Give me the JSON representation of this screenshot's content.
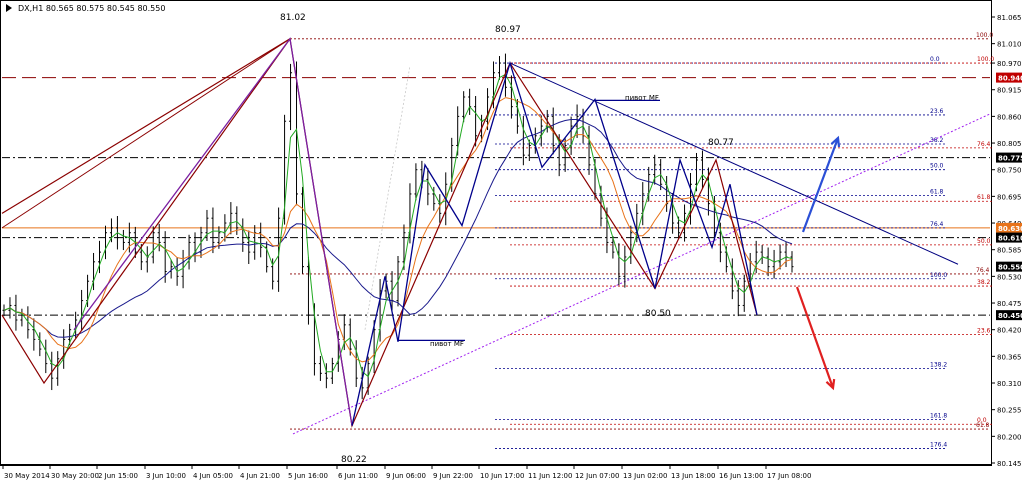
{
  "window": {
    "header": "DX,H1  80.565 80.575 80.545 80.550"
  },
  "chart_data": {
    "type": "candlestick",
    "symbol": "DX",
    "timeframe": "H1",
    "ylim": [
      80.165,
      81.085
    ],
    "grid": false,
    "price_axis": {
      "ticks": [
        "81.065",
        "81.010",
        "80.970",
        "80.915",
        "80.860",
        "80.805",
        "80.750",
        "80.695",
        "80.640",
        "80.585",
        "80.530",
        "80.475",
        "80.420",
        "80.365",
        "80.310",
        "80.255",
        "80.200",
        "80.145"
      ]
    },
    "time_axis": {
      "ticks": [
        "30 May 2014",
        "30 May 20:00",
        "2 Jun 15:00",
        "3 Jun 10:00",
        "4 Jun 05:00",
        "4 Jun 21:00",
        "5 Jun 16:00",
        "6 Jun 11:00",
        "9 Jun 06:00",
        "9 Jun 22:00",
        "10 Jun 17:00",
        "11 Jun 12:00",
        "12 Jun 07:00",
        "13 Jun 02:00",
        "13 Jun 18:00",
        "16 Jun 13:00",
        "17 Jun 08:00"
      ]
    },
    "axis_badges": [
      {
        "value": "80.940",
        "color": "#c00000"
      },
      {
        "value": "80.775",
        "color": "#000000"
      },
      {
        "value": "80.630",
        "color": "#e8731a"
      },
      {
        "value": "80.610",
        "color": "#000000"
      },
      {
        "value": "80.550",
        "color": "#000000"
      },
      {
        "value": "80.450",
        "color": "#000000"
      }
    ],
    "horizontal_levels": [
      {
        "price": 80.94,
        "color": "#8b0000",
        "style": "longdash"
      },
      {
        "price": 80.775,
        "color": "#000000",
        "style": "dashdot"
      },
      {
        "price": 80.63,
        "color": "#e8731a",
        "style": "solid"
      },
      {
        "price": 80.61,
        "color": "#000000",
        "style": "dashdot"
      },
      {
        "price": 80.45,
        "color": "#000000",
        "style": "dashdot"
      }
    ],
    "price_annotations": [
      {
        "label": "81.02",
        "price": 81.02
      },
      {
        "label": "80.97",
        "price": 80.97
      },
      {
        "label": "80.77",
        "price": 80.77
      },
      {
        "label": "80.50",
        "price": 80.5
      },
      {
        "label": "80.22",
        "price": 80.22
      }
    ],
    "text_notes": [
      {
        "text": "пивот MF"
      },
      {
        "text": "пивот MF"
      }
    ],
    "fib_levels": [
      {
        "label": "100.0",
        "price": 81.02,
        "color": "#8b0000"
      },
      {
        "label": "0.0",
        "price": 80.97,
        "color": "#00008b"
      },
      {
        "label": "100.0",
        "price": 80.97,
        "color": "#c00000"
      },
      {
        "label": "23.6",
        "price": 80.863,
        "color": "#00008b"
      },
      {
        "label": "38.2",
        "price": 80.803,
        "color": "#00008b"
      },
      {
        "label": "76.4",
        "price": 80.795,
        "color": "#c00000"
      },
      {
        "label": "50.0",
        "price": 80.75,
        "color": "#00008b"
      },
      {
        "label": "61.8",
        "price": 80.697,
        "color": "#00008b"
      },
      {
        "label": "61.8",
        "price": 80.685,
        "color": "#c00000"
      },
      {
        "label": "76.4",
        "price": 80.63,
        "color": "#00008b"
      },
      {
        "label": "50.0",
        "price": 80.595,
        "color": "#c00000"
      },
      {
        "label": "76.4",
        "price": 80.535,
        "color": "#8b0000"
      },
      {
        "label": "100.0",
        "price": 80.525,
        "color": "#00008b"
      },
      {
        "label": "38.2",
        "price": 80.51,
        "color": "#c00000"
      },
      {
        "label": "23.6",
        "price": 80.41,
        "color": "#c00000"
      },
      {
        "label": "138.2",
        "price": 80.34,
        "color": "#00008b"
      },
      {
        "label": "0.0",
        "price": 80.225,
        "color": "#c00000"
      },
      {
        "label": "161.8",
        "price": 80.235,
        "color": "#00008b"
      },
      {
        "label": "61.8",
        "price": 80.215,
        "color": "#8b0000"
      },
      {
        "label": "176.4",
        "price": 80.175,
        "color": "#00008b"
      }
    ],
    "series": [
      {
        "color": "#000000",
        "kind": "ohlc_bars",
        "close": [
          80.46,
          80.47,
          80.44,
          80.45,
          80.42,
          80.4,
          80.38,
          80.35,
          80.32,
          80.36,
          80.4,
          80.42,
          80.44,
          80.48,
          80.52,
          80.56,
          80.58,
          80.62,
          80.63,
          80.61,
          80.6,
          80.62,
          80.58,
          80.56,
          80.57,
          80.62,
          80.6,
          80.54,
          80.55,
          80.53,
          80.56,
          80.6,
          80.58,
          80.62,
          80.65,
          80.6,
          80.62,
          80.64,
          80.66,
          80.63,
          80.6,
          80.58,
          80.62,
          80.59,
          80.55,
          80.52,
          80.65,
          80.85,
          80.95,
          80.7,
          80.55,
          80.45,
          80.35,
          80.33,
          80.32,
          80.35,
          80.4,
          80.43,
          80.38,
          80.32,
          80.3,
          80.35,
          80.42,
          80.5,
          80.52,
          80.48,
          80.56,
          80.62,
          80.7,
          80.75,
          80.73,
          80.7,
          80.68,
          80.66,
          80.72,
          80.8,
          80.86,
          80.9,
          80.88,
          80.82,
          80.85,
          80.9,
          80.95,
          80.97,
          80.92,
          80.88,
          80.84,
          80.78,
          80.8,
          80.82,
          80.84,
          80.86,
          80.8,
          80.76,
          80.8,
          80.84,
          80.86,
          80.82,
          80.76,
          80.7,
          80.65,
          80.6,
          80.58,
          80.53,
          80.57,
          80.62,
          80.66,
          80.7,
          80.74,
          80.76,
          80.72,
          80.68,
          80.64,
          80.62,
          80.66,
          80.72,
          80.77,
          80.73,
          80.68,
          80.62,
          80.58,
          80.55,
          80.5,
          80.47,
          80.52,
          80.56,
          80.58,
          80.57,
          80.55,
          80.56,
          80.58,
          80.57,
          80.55
        ]
      },
      {
        "color": "#1a1a8c",
        "kind": "moving_average"
      },
      {
        "color": "#e8731a",
        "kind": "moving_average"
      },
      {
        "color": "#22aa22",
        "kind": "moving_average"
      }
    ],
    "trendlines": [
      {
        "color": "#000080"
      },
      {
        "color": "#a020f0",
        "style": "dotted"
      }
    ],
    "waves": [
      {
        "color": "#8b0000"
      },
      {
        "color": "#7b1fa2"
      },
      {
        "color": "#00008b"
      }
    ],
    "forecast_arrows": [
      {
        "direction": "up",
        "color": "#2b4fd6"
      },
      {
        "direction": "down",
        "color": "#e02020"
      }
    ]
  }
}
